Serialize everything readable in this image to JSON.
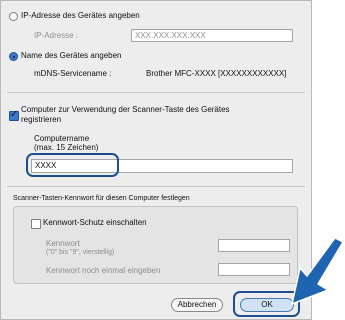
{
  "ip_option": {
    "label": "IP-Adresse des Gerätes angeben"
  },
  "ip_field": {
    "label": "IP-Adresse :",
    "placeholder": "XXX.XXX.XXX.XXX"
  },
  "name_option": {
    "label": "Name des Gerätes angeben"
  },
  "mdns": {
    "label": "mDNS-Servicename :",
    "value": "Brother MFC-XXXX  [XXXXXXXXXXXX]"
  },
  "scan_key": {
    "line1": "Computer zur Verwendung der Scanner-Taste des Gerätes",
    "line2": "registrieren"
  },
  "computer_name": {
    "label1": "Computername",
    "label2": "(max. 15 Zeichen)",
    "value": "XXXX"
  },
  "password_section": {
    "title": "Scanner-Tasten-Kennwort für diesen Computer festlegen",
    "enable_label": "Kennwort-Schutz einschalten",
    "password_label": "Kennwort",
    "password_hint": "(\"0\" bis \"9\", vierstellig)",
    "confirm_label": "Kennwort noch einmal eingeben"
  },
  "buttons": {
    "cancel": "Abbrechen",
    "ok": "OK"
  },
  "colors": {
    "highlight": "#1f4f8c",
    "arrow": "#1f64b0"
  },
  "icons": {
    "pointer": "callout-arrow-icon"
  }
}
